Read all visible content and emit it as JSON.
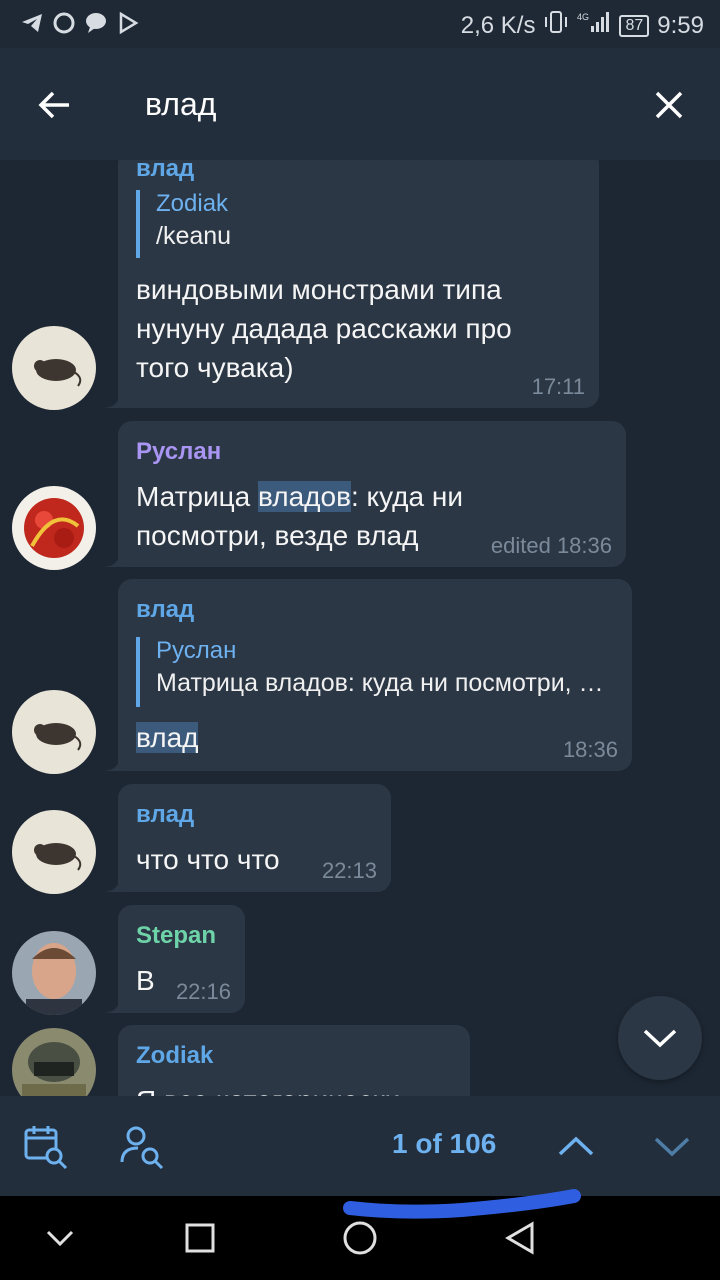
{
  "status_bar": {
    "speed": "2,6 K/s",
    "battery": "87",
    "time": "9:59",
    "icons": [
      "telegram-icon",
      "circle-icon",
      "chat-icon",
      "play-icon",
      "vibrate-icon",
      "signal-icon"
    ]
  },
  "header": {
    "search_query": "влад",
    "back_icon": "arrow-left-icon",
    "close_icon": "close-icon"
  },
  "messages": [
    {
      "sender": "влад",
      "reply_name": "Zodiak",
      "reply_text": "/keanu",
      "text_lines": [
        "виндовыми монстрами типа",
        "нунуну дадада расскажи про",
        "того чувака)"
      ],
      "time": "17:11"
    },
    {
      "sender": "Руслан",
      "text_pre": "Матрица ",
      "text_highlight": "владов",
      "text_post": ": куда ни",
      "text_line2": "посмотри, везде влад",
      "time": "edited 18:36"
    },
    {
      "sender": "влад",
      "reply_name": "Руслан",
      "reply_text": "Матрица владов: куда ни посмотри, везде влад",
      "text_highlight": "влад",
      "time": "18:36"
    },
    {
      "sender": "влад",
      "text": "что что что",
      "time": "22:13"
    },
    {
      "sender": "Stepan",
      "text": "В",
      "time": "22:16"
    },
    {
      "sender": "Zodiak",
      "text": "Я все категорически"
    }
  ],
  "search_bar": {
    "counter": "1 of 106",
    "icons": [
      "calendar-search-icon",
      "user-search-icon",
      "chevron-up-icon",
      "chevron-down-icon"
    ]
  },
  "nav_bar": {
    "icons": [
      "nav-down-icon",
      "recents-icon",
      "home-icon",
      "back-triangle-icon"
    ]
  },
  "colors": {
    "background": "#1d2733",
    "bubble": "#2b3745",
    "header": "#232e3c",
    "accent": "#5fa7e6",
    "highlight": "#3c5a7b",
    "scribble": "#2f5fe0"
  }
}
